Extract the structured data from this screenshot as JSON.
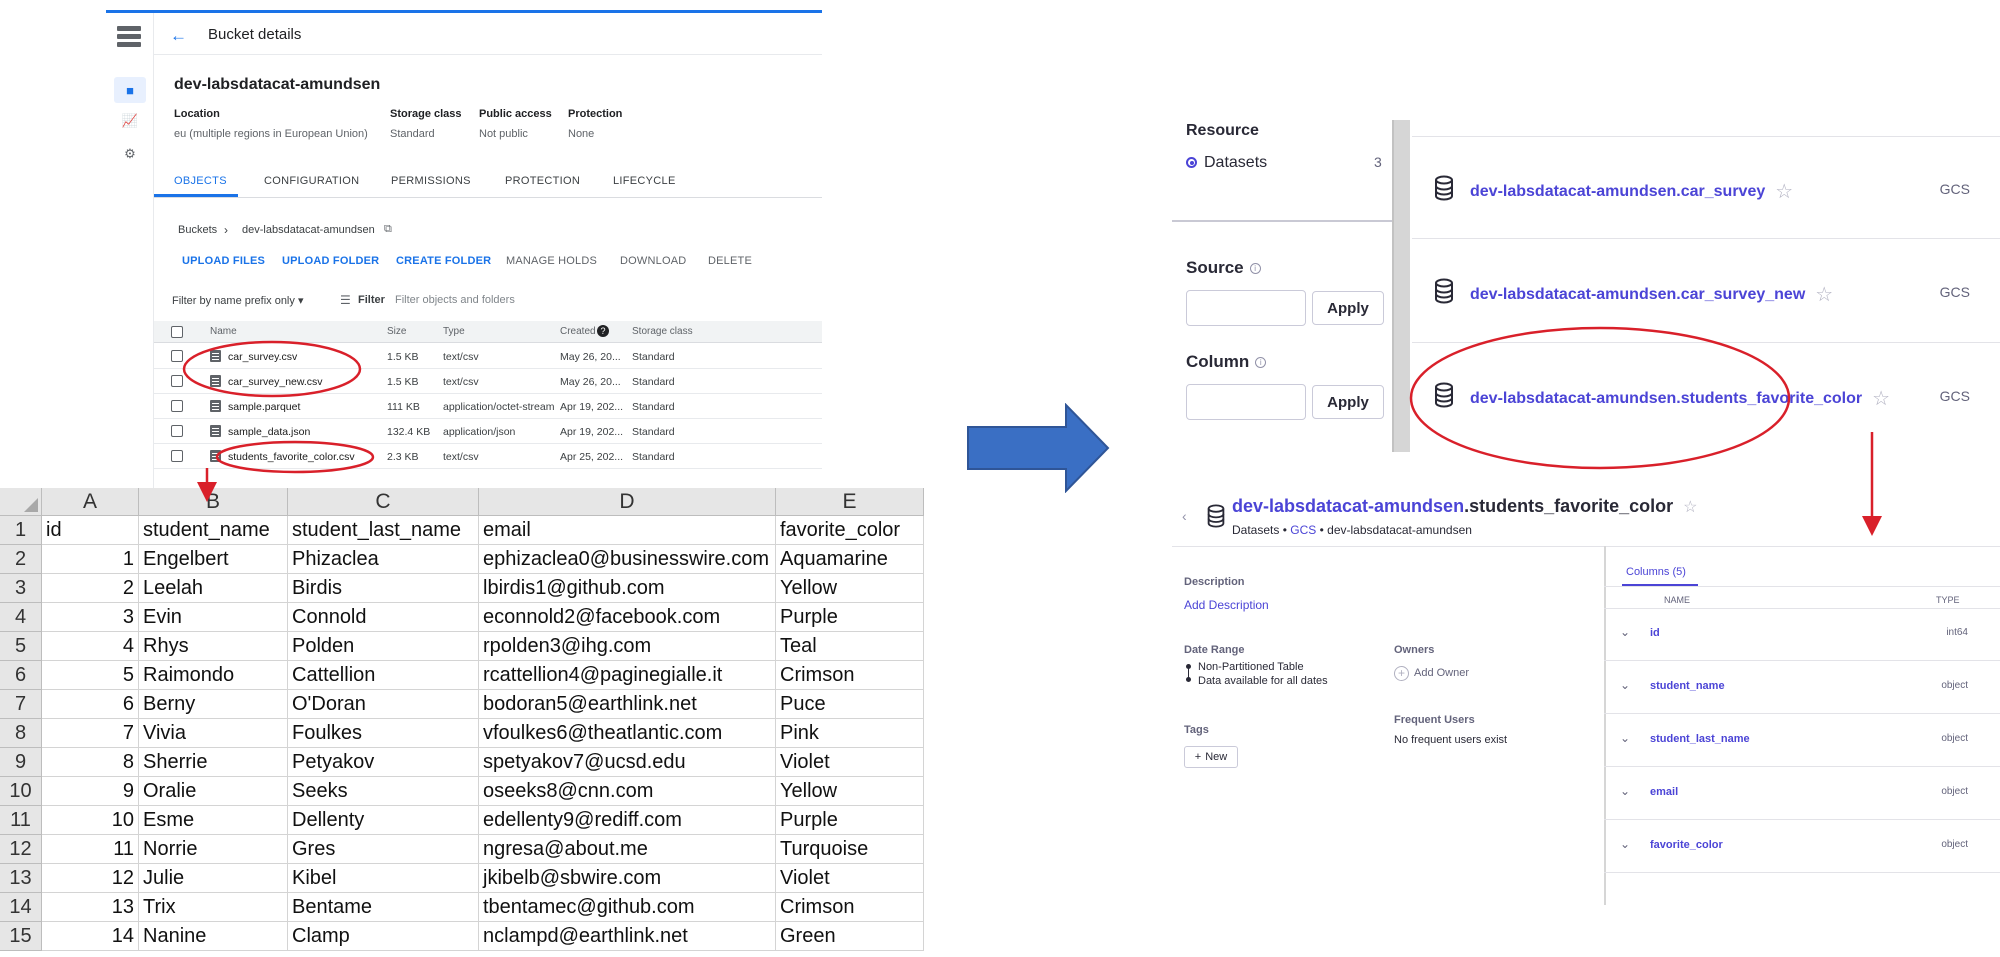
{
  "gcs": {
    "header_title": "Bucket details",
    "bucket_name": "dev-labsdatacat-amundsen",
    "info": [
      {
        "label": "Location",
        "value": "eu (multiple regions in European Union)"
      },
      {
        "label": "Storage class",
        "value": "Standard"
      },
      {
        "label": "Public access",
        "value": "Not public"
      },
      {
        "label": "Protection",
        "value": "None"
      }
    ],
    "tabs": [
      "OBJECTS",
      "CONFIGURATION",
      "PERMISSIONS",
      "PROTECTION",
      "LIFECYCLE"
    ],
    "active_tab": "OBJECTS",
    "breadcrumb": {
      "root": "Buckets",
      "separator": "›",
      "current": "dev-labsdatacat-amundsen"
    },
    "actions": [
      "UPLOAD FILES",
      "UPLOAD FOLDER",
      "CREATE FOLDER",
      "MANAGE HOLDS",
      "DOWNLOAD",
      "DELETE"
    ],
    "filter_prefix_label": "Filter by name prefix only",
    "filter_label": "Filter",
    "filter_placeholder": "Filter objects and folders",
    "columns": [
      "Name",
      "Size",
      "Type",
      "Created",
      "Storage class"
    ],
    "files": [
      {
        "name": "car_survey.csv",
        "size": "1.5 KB",
        "type": "text/csv",
        "created": "May 26, 20...",
        "storage": "Standard"
      },
      {
        "name": "car_survey_new.csv",
        "size": "1.5 KB",
        "type": "text/csv",
        "created": "May 26, 20...",
        "storage": "Standard"
      },
      {
        "name": "sample.parquet",
        "size": "111 KB",
        "type": "application/octet-stream",
        "created": "Apr 19, 202...",
        "storage": "Standard"
      },
      {
        "name": "sample_data.json",
        "size": "132.4 KB",
        "type": "application/json",
        "created": "Apr 19, 202...",
        "storage": "Standard"
      },
      {
        "name": "students_favorite_color.csv",
        "size": "2.3 KB",
        "type": "text/csv",
        "created": "Apr 25, 202...",
        "storage": "Standard"
      }
    ]
  },
  "sheet": {
    "col_letters": [
      "A",
      "B",
      "C",
      "D",
      "E"
    ],
    "rows": [
      [
        "id",
        "student_name",
        "student_last_name",
        "email",
        "favorite_color"
      ],
      [
        "1",
        "Engelbert",
        "Phizaclea",
        "ephizaclea0@businesswire.com",
        "Aquamarine"
      ],
      [
        "2",
        "Leelah",
        "Birdis",
        "lbirdis1@github.com",
        "Yellow"
      ],
      [
        "3",
        "Evin",
        "Connold",
        "econnold2@facebook.com",
        "Purple"
      ],
      [
        "4",
        "Rhys",
        "Polden",
        "rpolden3@ihg.com",
        "Teal"
      ],
      [
        "5",
        "Raimondo",
        "Cattellion",
        "rcattellion4@paginegialle.it",
        "Crimson"
      ],
      [
        "6",
        "Berny",
        "O'Doran",
        "bodoran5@earthlink.net",
        "Puce"
      ],
      [
        "7",
        "Vivia",
        "Foulkes",
        "vfoulkes6@theatlantic.com",
        "Pink"
      ],
      [
        "8",
        "Sherrie",
        "Petyakov",
        "spetyakov7@ucsd.edu",
        "Violet"
      ],
      [
        "9",
        "Oralie",
        "Seeks",
        "oseeks8@cnn.com",
        "Yellow"
      ],
      [
        "10",
        "Esme",
        "Dellenty",
        "edellenty9@rediff.com",
        "Purple"
      ],
      [
        "11",
        "Norrie",
        "Gres",
        "ngresa@about.me",
        "Turquoise"
      ],
      [
        "12",
        "Julie",
        "Kibel",
        "jkibelb@sbwire.com",
        "Violet"
      ],
      [
        "13",
        "Trix",
        "Bentame",
        "tbentamec@github.com",
        "Crimson"
      ],
      [
        "14",
        "Nanine",
        "Clamp",
        "nclampd@earthlink.net",
        "Green"
      ]
    ]
  },
  "search": {
    "resource_title": "Resource",
    "resource_option": "Datasets",
    "resource_count": "3",
    "source_title": "Source",
    "column_title": "Column",
    "apply_label": "Apply",
    "results": [
      {
        "name": "dev-labsdatacat-amundsen.car_survey",
        "source": "GCS"
      },
      {
        "name": "dev-labsdatacat-amundsen.car_survey_new",
        "source": "GCS"
      },
      {
        "name": "dev-labsdatacat-amundsen.students_favorite_color",
        "source": "GCS"
      }
    ]
  },
  "detail": {
    "schema": "dev-labsdatacat-amundsen",
    "table": ".students_favorite_color",
    "breadcrumb": {
      "datasets": "Datasets",
      "sep": "•",
      "source": "GCS",
      "bucket": "dev-labsdatacat-amundsen"
    },
    "description_title": "Description",
    "add_description": "Add Description",
    "date_range_title": "Date Range",
    "date_range_line1": "Non-Partitioned Table",
    "date_range_line2": "Data available for all dates",
    "tags_title": "Tags",
    "new_tag": "New",
    "owners_title": "Owners",
    "add_owner": "Add Owner",
    "frequent_users_title": "Frequent Users",
    "frequent_users_text": "No frequent users exist",
    "columns_tab": "Columns (5)",
    "col_name_header": "NAME",
    "col_type_header": "TYPE",
    "columns": [
      {
        "name": "id",
        "type": "int64"
      },
      {
        "name": "student_name",
        "type": "object"
      },
      {
        "name": "student_last_name",
        "type": "object"
      },
      {
        "name": "email",
        "type": "object"
      },
      {
        "name": "favorite_color",
        "type": "object"
      }
    ]
  },
  "colors": {
    "gcs_blue": "#1a73e8",
    "amundsen_purple": "#4b44d6",
    "annotation_red": "#d9202a",
    "arrow_blue": "#3a6fc4"
  }
}
